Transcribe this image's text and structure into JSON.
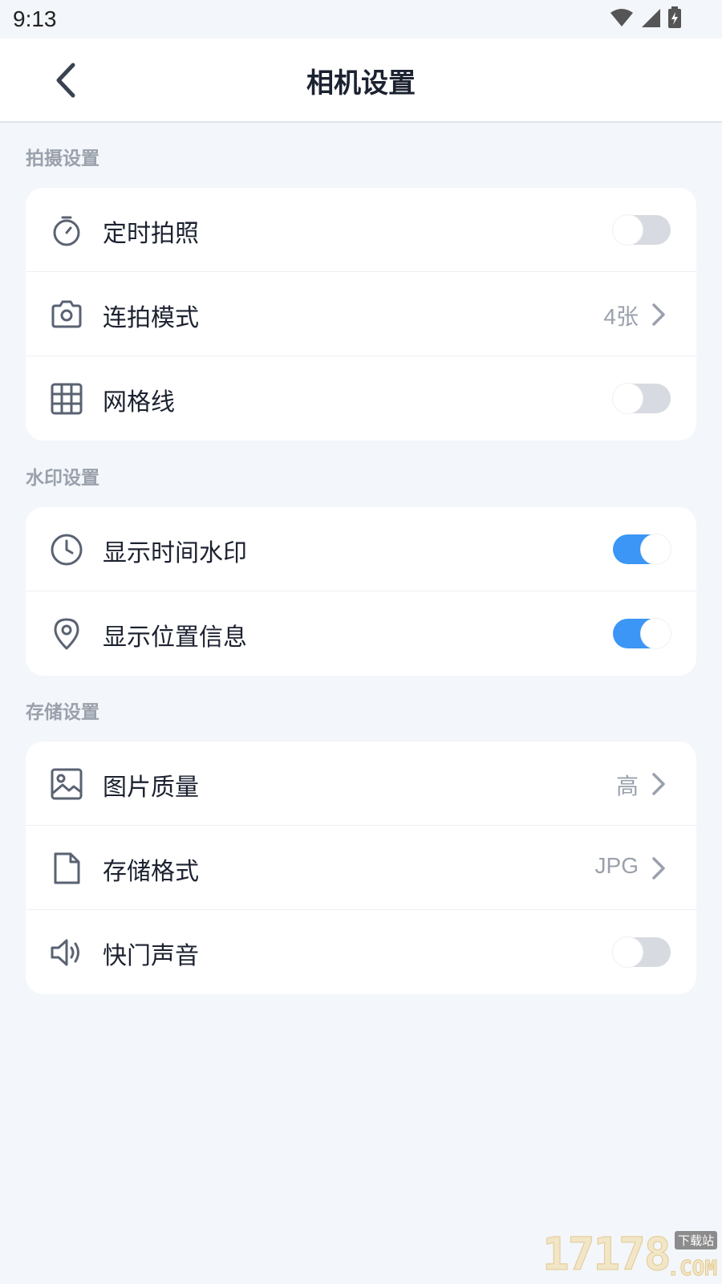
{
  "status_bar": {
    "time": "9:13"
  },
  "header": {
    "title": "相机设置"
  },
  "sections": [
    {
      "title": "拍摄设置",
      "rows": [
        {
          "icon": "timer-icon",
          "label": "定时拍照",
          "type": "toggle",
          "on": false
        },
        {
          "icon": "camera-icon",
          "label": "连拍模式",
          "type": "value",
          "value": "4张"
        },
        {
          "icon": "grid-icon",
          "label": "网格线",
          "type": "toggle",
          "on": false
        }
      ]
    },
    {
      "title": "水印设置",
      "rows": [
        {
          "icon": "clock-icon",
          "label": "显示时间水印",
          "type": "toggle",
          "on": true
        },
        {
          "icon": "location-pin-icon",
          "label": "显示位置信息",
          "type": "toggle",
          "on": true
        }
      ]
    },
    {
      "title": "存储设置",
      "rows": [
        {
          "icon": "image-icon",
          "label": "图片质量",
          "type": "value",
          "value": "高"
        },
        {
          "icon": "file-icon",
          "label": "存储格式",
          "type": "value",
          "value": "JPG"
        },
        {
          "icon": "speaker-icon",
          "label": "快门声音",
          "type": "toggle",
          "on": false
        }
      ]
    }
  ],
  "watermark": {
    "number": "17178",
    "tag": "下载站",
    "suffix": ".COM"
  },
  "colors": {
    "accent": "#3b96f5",
    "background": "#f3f6fa",
    "toggle_off": "#d7dae0"
  }
}
